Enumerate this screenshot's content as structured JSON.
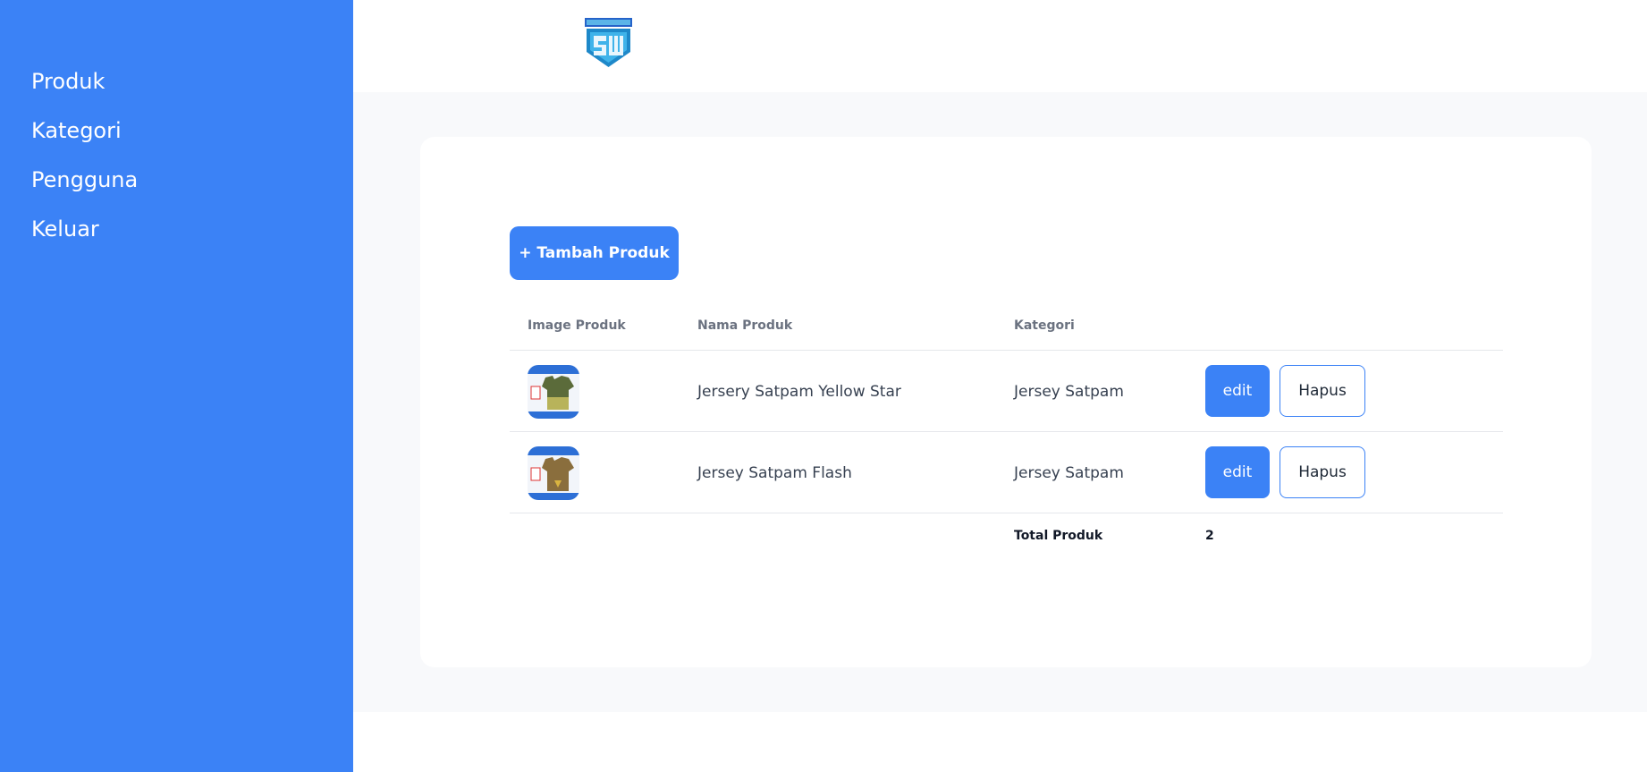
{
  "sidebar": {
    "items": [
      {
        "label": "Produk"
      },
      {
        "label": "Kategori"
      },
      {
        "label": "Pengguna"
      },
      {
        "label": "Keluar"
      }
    ]
  },
  "header": {
    "logo_icon": "shield-sw-logo"
  },
  "main": {
    "add_button": "+ Tambah Produk",
    "table": {
      "headers": {
        "image": "Image Produk",
        "name": "Nama Produk",
        "category": "Kategori"
      },
      "rows": [
        {
          "name": "Jersery Satpam Yellow Star",
          "category": "Jersey Satpam",
          "edit": "edit",
          "delete": "Hapus",
          "thumb_color": "#5b6b3a"
        },
        {
          "name": "Jersey Satpam Flash",
          "category": "Jersey Satpam",
          "edit": "edit",
          "delete": "Hapus",
          "thumb_color": "#8a6e3d"
        }
      ],
      "total": {
        "label": "Total Produk",
        "value": "2"
      }
    }
  },
  "colors": {
    "accent": "#3b82f6",
    "background": "#f8f9fb",
    "card": "#ffffff"
  }
}
